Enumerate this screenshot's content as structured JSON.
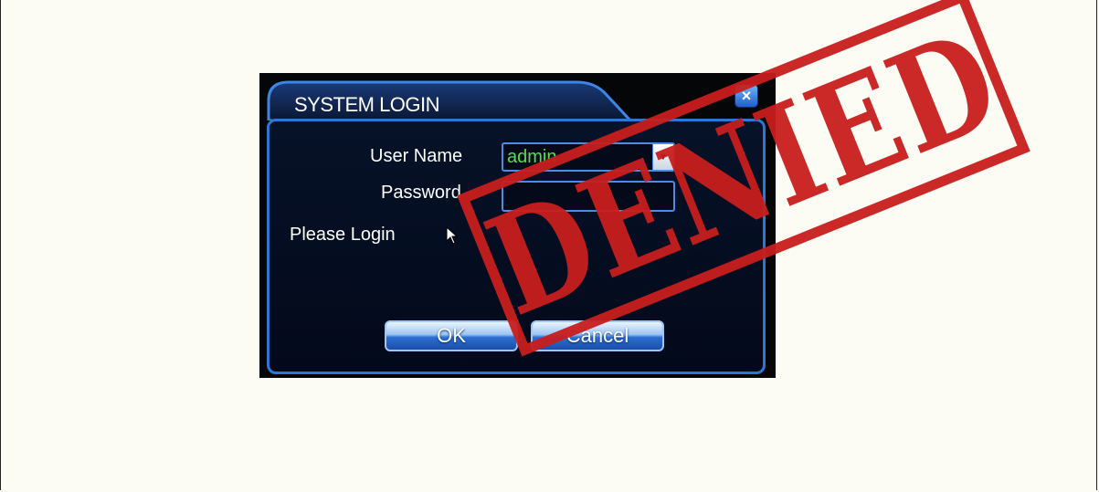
{
  "dialog": {
    "title": "SYSTEM LOGIN",
    "close_glyph": "×",
    "user_label": "User Name",
    "user_value": "admin",
    "password_label": "Password",
    "status_text": "Please Login",
    "ok_label": "OK",
    "cancel_label": "Cancel"
  },
  "stamp": {
    "text": "DENIED",
    "color": "#c81e1e"
  },
  "colors": {
    "accent_blue": "#2a77d8",
    "user_text_green": "#4fe04f"
  }
}
